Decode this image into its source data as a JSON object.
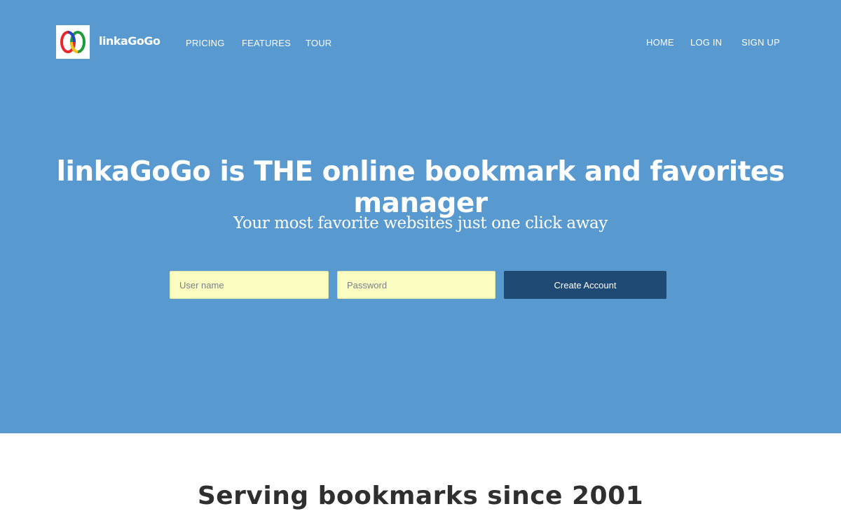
{
  "header": {
    "brand": "linkaGoGo",
    "logo_icon": "interlinked-rings-logo",
    "nav_left": [
      "PRICING",
      "FEATURES",
      "TOUR"
    ],
    "nav_right": [
      "HOME",
      "LOG IN",
      "SIGN UP"
    ]
  },
  "hero": {
    "headline": "linkaGoGo is THE online bookmark and favorites manager",
    "subline": "Your most favorite websites just one click away",
    "username_placeholder": "User name",
    "password_placeholder": "Password",
    "create_button": "Create Account"
  },
  "section": {
    "serving_prefix": "Serving bookmarks ",
    "serving_bold": "since 2001"
  },
  "colors": {
    "hero_bg": "#5899d0",
    "input_bg": "#fbfcbf",
    "button_bg": "#1e4a73"
  }
}
